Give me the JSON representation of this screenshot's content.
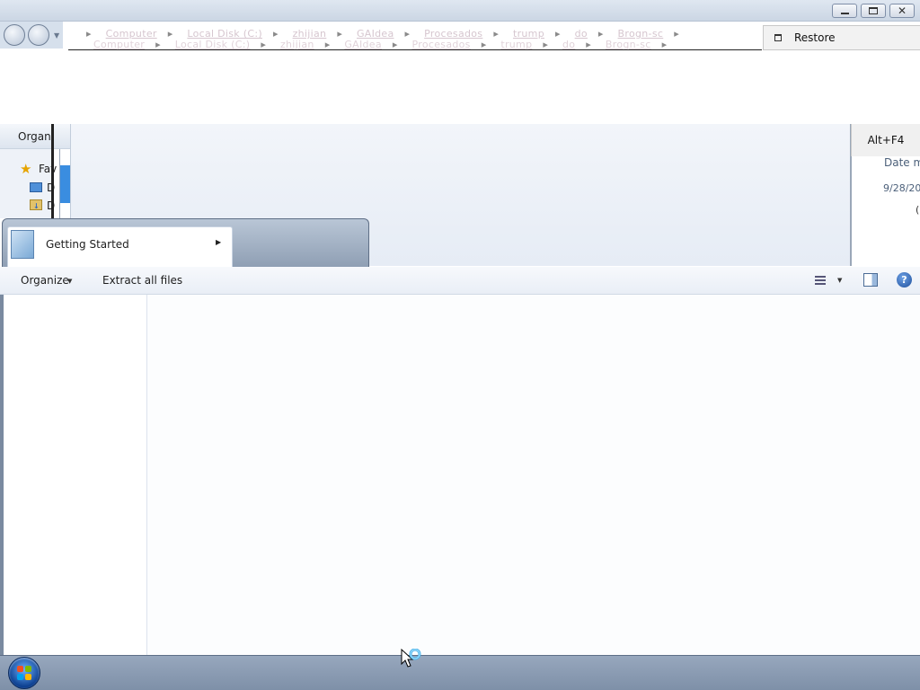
{
  "window_controls": {
    "minimize_icon": "minimize-icon",
    "maximize_icon": "restore-down-icon",
    "close_label": "✕"
  },
  "address_bar": {
    "ghost_line_1": [
      "Computer",
      "Local Disk (C:)",
      "zhijian",
      "GAIdea",
      "Procesados",
      "trump",
      "do",
      "Brogn-sc"
    ],
    "ghost_line_2": [
      "Computer",
      "Local Disk (C:)",
      "zhijian",
      "GAIdea",
      "Procesados",
      "trump",
      "do",
      "Brogn-sc"
    ],
    "separator": "▸"
  },
  "context_menu": {
    "restore_label": "Restore",
    "close_shortcut": "Alt+F4"
  },
  "background_window": {
    "organize_label": "Organi",
    "favorites_label": "Fav",
    "item_fragment_1": "D",
    "item_fragment_2": "D",
    "column_header_fragment": "Date m",
    "row_date_fragment": "9/28/20",
    "row_fragment": "("
  },
  "start_menu": {
    "item_label": "Getting Started",
    "submenu_arrow": "▶"
  },
  "foreground_window": {
    "toolbar": {
      "organize_label": "Organize",
      "organize_arrow": "▼",
      "extract_label": "Extract all files",
      "views_arrow": "▼",
      "help_label": "?"
    }
  },
  "taskbar": {
    "start_button": "windows-flag-icon"
  },
  "colors": {
    "taskbar": "#8a9bb2",
    "toolbar": "#eef2f8",
    "accent": "#1e4f9b"
  }
}
